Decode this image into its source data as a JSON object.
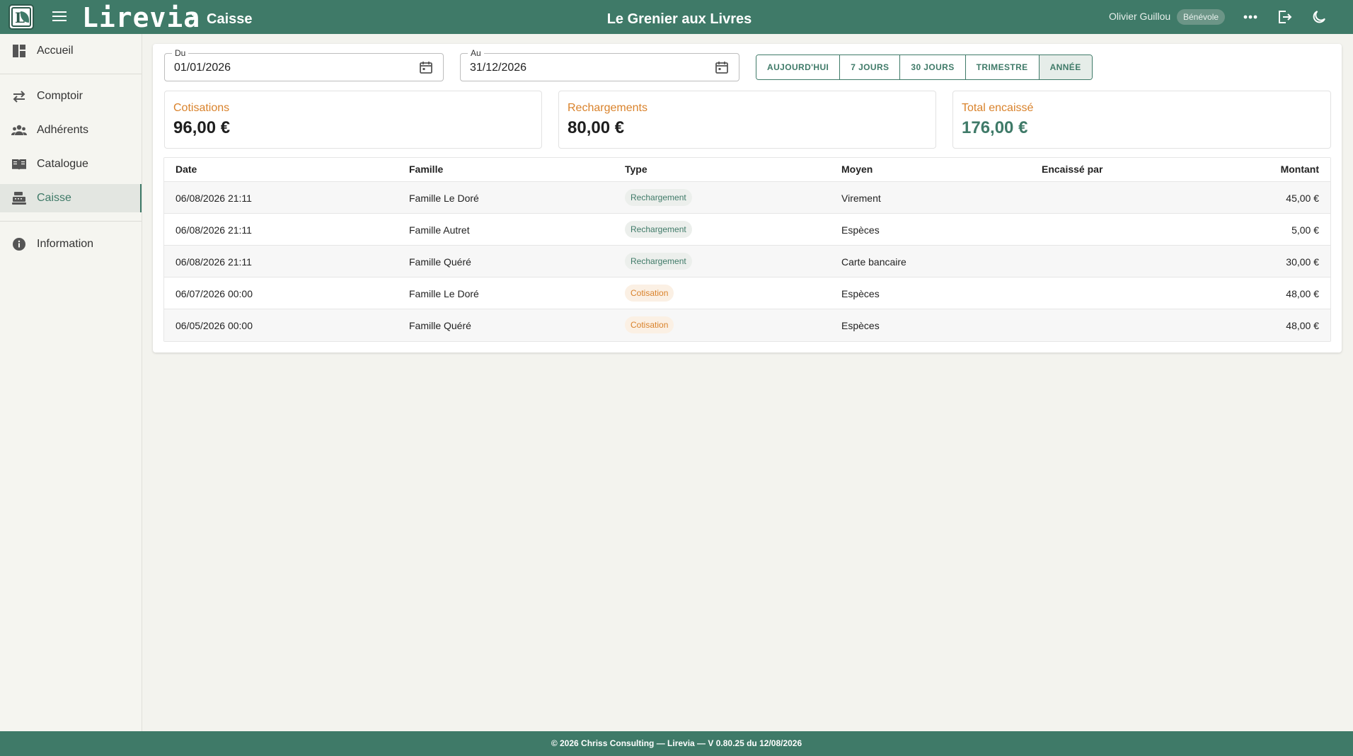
{
  "header": {
    "brand": "Lirevia",
    "breadcrumb_sep": "›",
    "breadcrumb": "Caisse",
    "shop_title": "Le Grenier aux Livres",
    "user_name": "Olivier Guillou",
    "user_role": "Bénévole",
    "icons": [
      "menu-icon",
      "more-icon",
      "logout-icon",
      "dark-mode-icon"
    ]
  },
  "sidebar": {
    "items": [
      {
        "label": "Accueil",
        "icon": "dashboard-icon"
      },
      {
        "label": "Comptoir",
        "icon": "swap-icon"
      },
      {
        "label": "Adhérents",
        "icon": "group-icon"
      },
      {
        "label": "Catalogue",
        "icon": "book-icon"
      },
      {
        "label": "Caisse",
        "icon": "cash-register-icon",
        "active": true
      },
      {
        "label": "Information",
        "icon": "info-icon"
      }
    ]
  },
  "filters": {
    "from_label": "Du",
    "from_value": "01/01/2026",
    "to_label": "Au",
    "to_value": "31/12/2026",
    "ranges": [
      "AUJOURD'HUI",
      "7 JOURS",
      "30 JOURS",
      "TRIMESTRE",
      "ANNÉE"
    ],
    "active_range": "ANNÉE"
  },
  "stats": {
    "cotisations_label": "Cotisations",
    "cotisations_value": "96,00 €",
    "recharges_label": "Rechargements",
    "recharges_value": "80,00 €",
    "total_label": "Total encaissé",
    "total_value": "176,00 €"
  },
  "table": {
    "headers": {
      "date": "Date",
      "famille": "Famille",
      "type": "Type",
      "moyen": "Moyen",
      "par": "Encaissé par",
      "montant": "Montant"
    },
    "rows": [
      {
        "date": "06/08/2026 21:11",
        "famille": "Famille Le Doré",
        "type": "Rechargement",
        "moyen": "Virement",
        "par": "",
        "montant": "45,00 €"
      },
      {
        "date": "06/08/2026 21:11",
        "famille": "Famille Autret",
        "type": "Rechargement",
        "moyen": "Espèces",
        "par": "",
        "montant": "5,00 €"
      },
      {
        "date": "06/08/2026 21:11",
        "famille": "Famille Quéré",
        "type": "Rechargement",
        "moyen": "Carte bancaire",
        "par": "",
        "montant": "30,00 €"
      },
      {
        "date": "06/07/2026 00:00",
        "famille": "Famille Le Doré",
        "type": "Cotisation",
        "moyen": "Espèces",
        "par": "",
        "montant": "48,00 €"
      },
      {
        "date": "06/05/2026 00:00",
        "famille": "Famille Quéré",
        "type": "Cotisation",
        "moyen": "Espèces",
        "par": "",
        "montant": "48,00 €"
      }
    ]
  },
  "footer": {
    "text": "© 2026 Chriss Consulting — Lirevia — V 0.80.25 du 12/08/2026"
  },
  "colors": {
    "primary": "#3f7a68",
    "accent_orange": "#d9822b",
    "background": "#f3f3ee"
  }
}
